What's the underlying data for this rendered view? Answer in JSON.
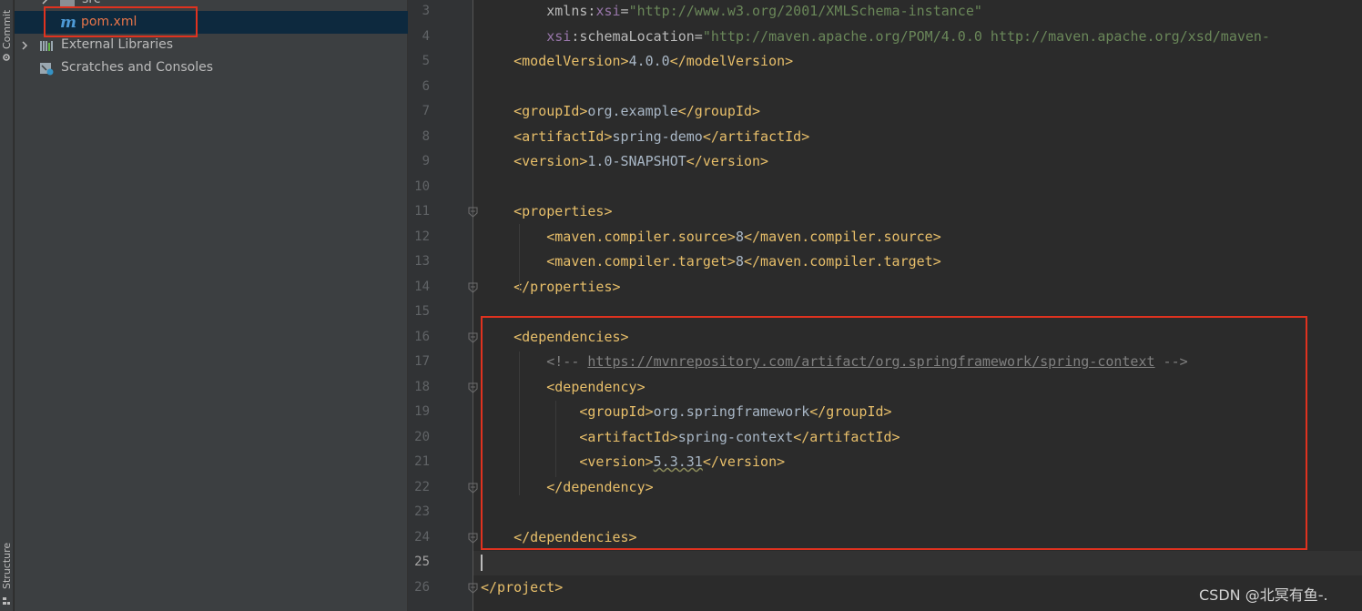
{
  "sidebar": {
    "commit_label": "Commit",
    "structure_label": "Structure"
  },
  "project_tree": {
    "src_label": "src",
    "pom_label": "pom.xml",
    "external_libraries_label": "External Libraries",
    "scratches_label": "Scratches and Consoles"
  },
  "editor": {
    "current_line": 25,
    "lines": [
      {
        "n": "3",
        "segments": [
          {
            "t": "        xmlns",
            "c": "attr"
          },
          {
            "t": ":",
            "c": "attr"
          },
          {
            "t": "xsi",
            "c": "ns"
          },
          {
            "t": "=",
            "c": "attr"
          },
          {
            "t": "\"http://www.w3.org/2001/XMLSchema-instance\"",
            "c": "val"
          }
        ]
      },
      {
        "n": "4",
        "segments": [
          {
            "t": "        ",
            "c": "attr"
          },
          {
            "t": "xsi",
            "c": "ns"
          },
          {
            "t": ":schemaLocation=",
            "c": "attr"
          },
          {
            "t": "\"http://maven.apache.org/POM/4.0.0 http://maven.apache.org/xsd/maven-",
            "c": "val"
          }
        ]
      },
      {
        "n": "5",
        "segments": [
          {
            "t": "    <modelVersion>",
            "c": "tag"
          },
          {
            "t": "4.0.0",
            "c": "txt"
          },
          {
            "t": "</modelVersion>",
            "c": "tag"
          }
        ]
      },
      {
        "n": "6",
        "segments": []
      },
      {
        "n": "7",
        "segments": [
          {
            "t": "    <groupId>",
            "c": "tag"
          },
          {
            "t": "org.example",
            "c": "txt"
          },
          {
            "t": "</groupId>",
            "c": "tag"
          }
        ]
      },
      {
        "n": "8",
        "segments": [
          {
            "t": "    <artifactId>",
            "c": "tag"
          },
          {
            "t": "spring-demo",
            "c": "txt"
          },
          {
            "t": "</artifactId>",
            "c": "tag"
          }
        ]
      },
      {
        "n": "9",
        "segments": [
          {
            "t": "    <version>",
            "c": "tag"
          },
          {
            "t": "1.0-SNAPSHOT",
            "c": "txt"
          },
          {
            "t": "</version>",
            "c": "tag"
          }
        ]
      },
      {
        "n": "10",
        "segments": []
      },
      {
        "n": "11",
        "segments": [
          {
            "t": "    <properties>",
            "c": "tag"
          }
        ]
      },
      {
        "n": "12",
        "segments": [
          {
            "t": "        <maven.compiler.source>",
            "c": "tag"
          },
          {
            "t": "8",
            "c": "txt"
          },
          {
            "t": "</maven.compiler.source>",
            "c": "tag"
          }
        ]
      },
      {
        "n": "13",
        "segments": [
          {
            "t": "        <maven.compiler.target>",
            "c": "tag"
          },
          {
            "t": "8",
            "c": "txt"
          },
          {
            "t": "</maven.compiler.target>",
            "c": "tag"
          }
        ]
      },
      {
        "n": "14",
        "segments": [
          {
            "t": "    </properties>",
            "c": "tag"
          }
        ]
      },
      {
        "n": "15",
        "segments": []
      },
      {
        "n": "16",
        "segments": [
          {
            "t": "    <dependencies>",
            "c": "tag"
          }
        ]
      },
      {
        "n": "17",
        "segments": [
          {
            "t": "        <!-- ",
            "c": "cmt"
          },
          {
            "t": "https://mvnrepository.com/artifact/org.springframework/spring-context",
            "c": "link"
          },
          {
            "t": " -->",
            "c": "cmt"
          }
        ]
      },
      {
        "n": "18",
        "segments": [
          {
            "t": "        <dependency>",
            "c": "tag"
          }
        ]
      },
      {
        "n": "19",
        "segments": [
          {
            "t": "            <groupId>",
            "c": "tag"
          },
          {
            "t": "org.springframework",
            "c": "txt"
          },
          {
            "t": "</groupId>",
            "c": "tag"
          }
        ]
      },
      {
        "n": "20",
        "segments": [
          {
            "t": "            <artifactId>",
            "c": "tag"
          },
          {
            "t": "spring-context",
            "c": "txt"
          },
          {
            "t": "</artifactId>",
            "c": "tag"
          }
        ]
      },
      {
        "n": "21",
        "segments": [
          {
            "t": "            <version>",
            "c": "tag"
          },
          {
            "t": "5.3.31",
            "c": "squig"
          },
          {
            "t": "</version>",
            "c": "tag"
          }
        ]
      },
      {
        "n": "22",
        "segments": [
          {
            "t": "        </dependency>",
            "c": "tag"
          }
        ]
      },
      {
        "n": "23",
        "segments": []
      },
      {
        "n": "24",
        "segments": [
          {
            "t": "    </dependencies>",
            "c": "tag"
          }
        ]
      },
      {
        "n": "25",
        "segments": []
      },
      {
        "n": "26",
        "segments": [
          {
            "t": "</project>",
            "c": "tag"
          }
        ]
      }
    ],
    "fold_markers": [
      "11",
      "14",
      "16",
      "18",
      "22",
      "24",
      "26"
    ]
  },
  "watermark": "CSDN @北冥有鱼-."
}
